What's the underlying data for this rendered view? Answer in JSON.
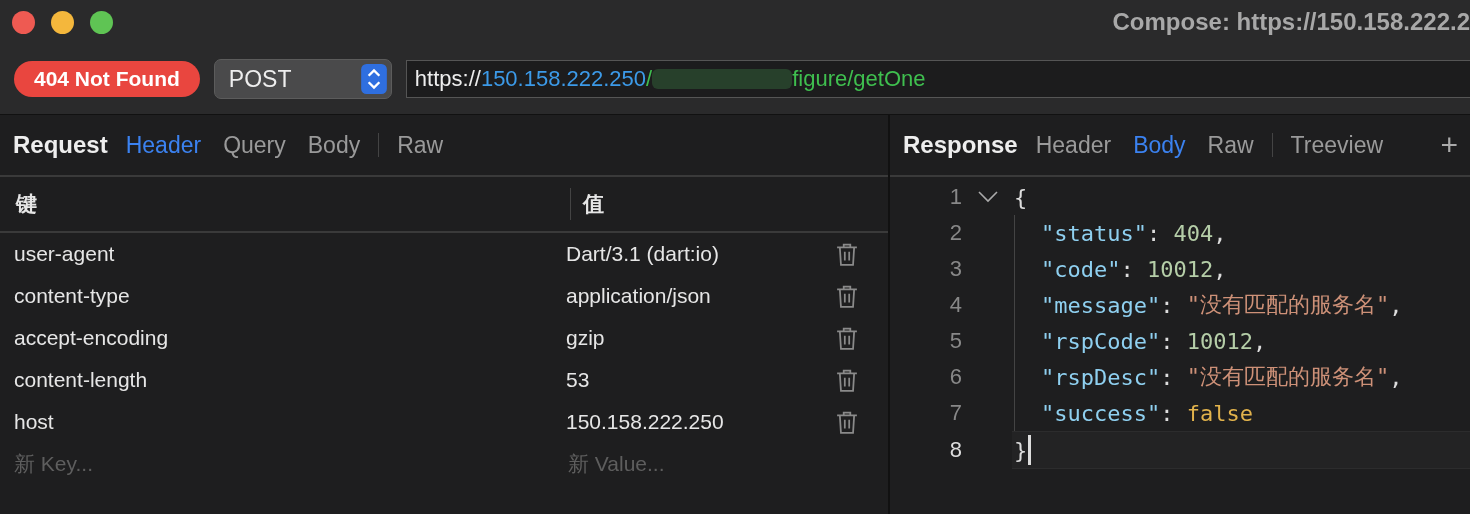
{
  "window": {
    "title": "Compose: https://150.158.222.2"
  },
  "toolbar": {
    "status_badge": "404 Not Found",
    "method": "POST",
    "url": {
      "scheme": "https://",
      "host": "150.158.222.250",
      "path_start": "/",
      "path_end": "figure/getOne"
    }
  },
  "request": {
    "title": "Request",
    "tabs": [
      {
        "label": "Header",
        "selected": true
      },
      {
        "label": "Query",
        "selected": false
      },
      {
        "label": "Body",
        "selected": false
      },
      {
        "label": "Raw",
        "selected": false
      }
    ],
    "table": {
      "columns": [
        "键",
        "值"
      ],
      "rows": [
        {
          "key": "user-agent",
          "value": "Dart/3.1 (dart:io)"
        },
        {
          "key": "content-type",
          "value": "application/json"
        },
        {
          "key": "accept-encoding",
          "value": "gzip"
        },
        {
          "key": "content-length",
          "value": "53"
        },
        {
          "key": "host",
          "value": "150.158.222.250"
        }
      ],
      "new_row": {
        "key_placeholder": "新 Key...",
        "value_placeholder": "新 Value..."
      }
    }
  },
  "response": {
    "title": "Response",
    "tabs": [
      {
        "label": "Header",
        "selected": false
      },
      {
        "label": "Body",
        "selected": true
      },
      {
        "label": "Raw",
        "selected": false
      },
      {
        "label": "Treeview",
        "selected": false
      }
    ],
    "add_tab": "+",
    "code": [
      {
        "number": "1",
        "fold": true,
        "indent": false,
        "tokens": [
          {
            "kind": "punct",
            "text": "{"
          }
        ]
      },
      {
        "number": "2",
        "fold": false,
        "indent": true,
        "tokens": [
          {
            "kind": "key",
            "text": "\"status\""
          },
          {
            "kind": "punct",
            "text": ": "
          },
          {
            "kind": "number",
            "text": "404"
          },
          {
            "kind": "punct",
            "text": ","
          }
        ]
      },
      {
        "number": "3",
        "fold": false,
        "indent": true,
        "tokens": [
          {
            "kind": "key",
            "text": "\"code\""
          },
          {
            "kind": "punct",
            "text": ": "
          },
          {
            "kind": "number",
            "text": "10012"
          },
          {
            "kind": "punct",
            "text": ","
          }
        ]
      },
      {
        "number": "4",
        "fold": false,
        "indent": true,
        "tokens": [
          {
            "kind": "key",
            "text": "\"message\""
          },
          {
            "kind": "punct",
            "text": ": "
          },
          {
            "kind": "string",
            "text": "\"没有匹配的服务名\""
          },
          {
            "kind": "punct",
            "text": ","
          }
        ]
      },
      {
        "number": "5",
        "fold": false,
        "indent": true,
        "tokens": [
          {
            "kind": "key",
            "text": "\"rspCode\""
          },
          {
            "kind": "punct",
            "text": ": "
          },
          {
            "kind": "number",
            "text": "10012"
          },
          {
            "kind": "punct",
            "text": ","
          }
        ]
      },
      {
        "number": "6",
        "fold": false,
        "indent": true,
        "tokens": [
          {
            "kind": "key",
            "text": "\"rspDesc\""
          },
          {
            "kind": "punct",
            "text": ": "
          },
          {
            "kind": "string",
            "text": "\"没有匹配的服务名\""
          },
          {
            "kind": "punct",
            "text": ","
          }
        ]
      },
      {
        "number": "7",
        "fold": false,
        "indent": true,
        "tokens": [
          {
            "kind": "key",
            "text": "\"success\""
          },
          {
            "kind": "punct",
            "text": ": "
          },
          {
            "kind": "boolean",
            "text": "false"
          }
        ]
      },
      {
        "number": "8",
        "fold": false,
        "indent": false,
        "current": true,
        "tokens": [
          {
            "kind": "punct",
            "text": "}"
          }
        ]
      }
    ]
  }
}
